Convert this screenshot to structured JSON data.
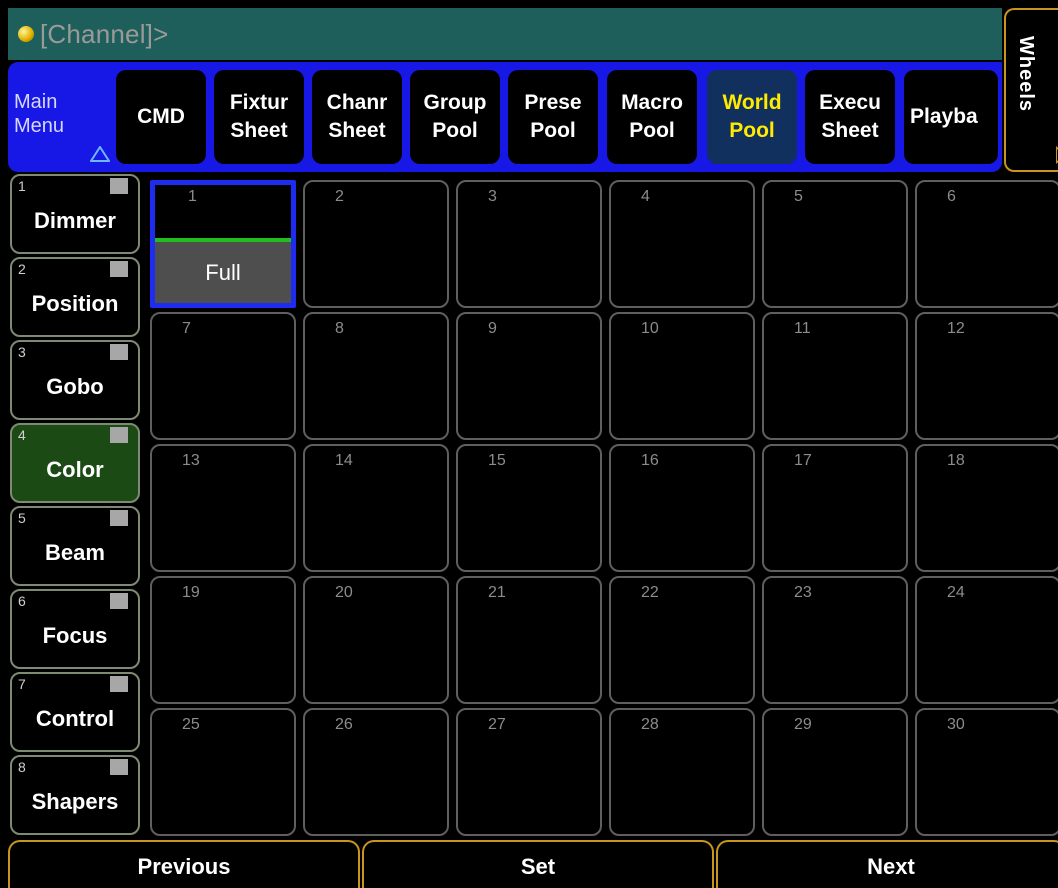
{
  "command_line": {
    "text": "[Channel]>"
  },
  "wheels_tab": {
    "label": "Wheels"
  },
  "menu_bar": {
    "main_menu": {
      "line1": "Main",
      "line2": "Menu"
    },
    "buttons": [
      {
        "line1": "CMD",
        "line2": ""
      },
      {
        "line1": "Fixtur",
        "line2": "Sheet"
      },
      {
        "line1": "Chanr",
        "line2": "Sheet"
      },
      {
        "line1": "Group",
        "line2": "Pool"
      },
      {
        "line1": "Prese",
        "line2": "Pool"
      },
      {
        "line1": "Macro",
        "line2": "Pool"
      },
      {
        "line1": "World",
        "line2": "Pool",
        "active": true
      },
      {
        "line1": "Execu",
        "line2": "Sheet"
      },
      {
        "line1": "Playba",
        "line2": ""
      }
    ]
  },
  "preset_types": [
    {
      "num": "1",
      "label": "Dimmer"
    },
    {
      "num": "2",
      "label": "Position"
    },
    {
      "num": "3",
      "label": "Gobo"
    },
    {
      "num": "4",
      "label": "Color",
      "active": true
    },
    {
      "num": "5",
      "label": "Beam"
    },
    {
      "num": "6",
      "label": "Focus"
    },
    {
      "num": "7",
      "label": "Control"
    },
    {
      "num": "8",
      "label": "Shapers"
    }
  ],
  "pool": {
    "cells": [
      "1",
      "2",
      "3",
      "4",
      "5",
      "6",
      "7",
      "8",
      "9",
      "10",
      "11",
      "12",
      "13",
      "14",
      "15",
      "16",
      "17",
      "18",
      "19",
      "20",
      "21",
      "22",
      "23",
      "24",
      "25",
      "26",
      "27",
      "28",
      "29",
      "30"
    ],
    "selected_cell": "1",
    "selected_preset_label": "Full",
    "accent_colors": {
      "selection": "#1e2cf0",
      "bar": "#1fbf1f"
    }
  },
  "bottom_bar": {
    "previous": "Previous",
    "set": "Set",
    "next": "Next"
  }
}
